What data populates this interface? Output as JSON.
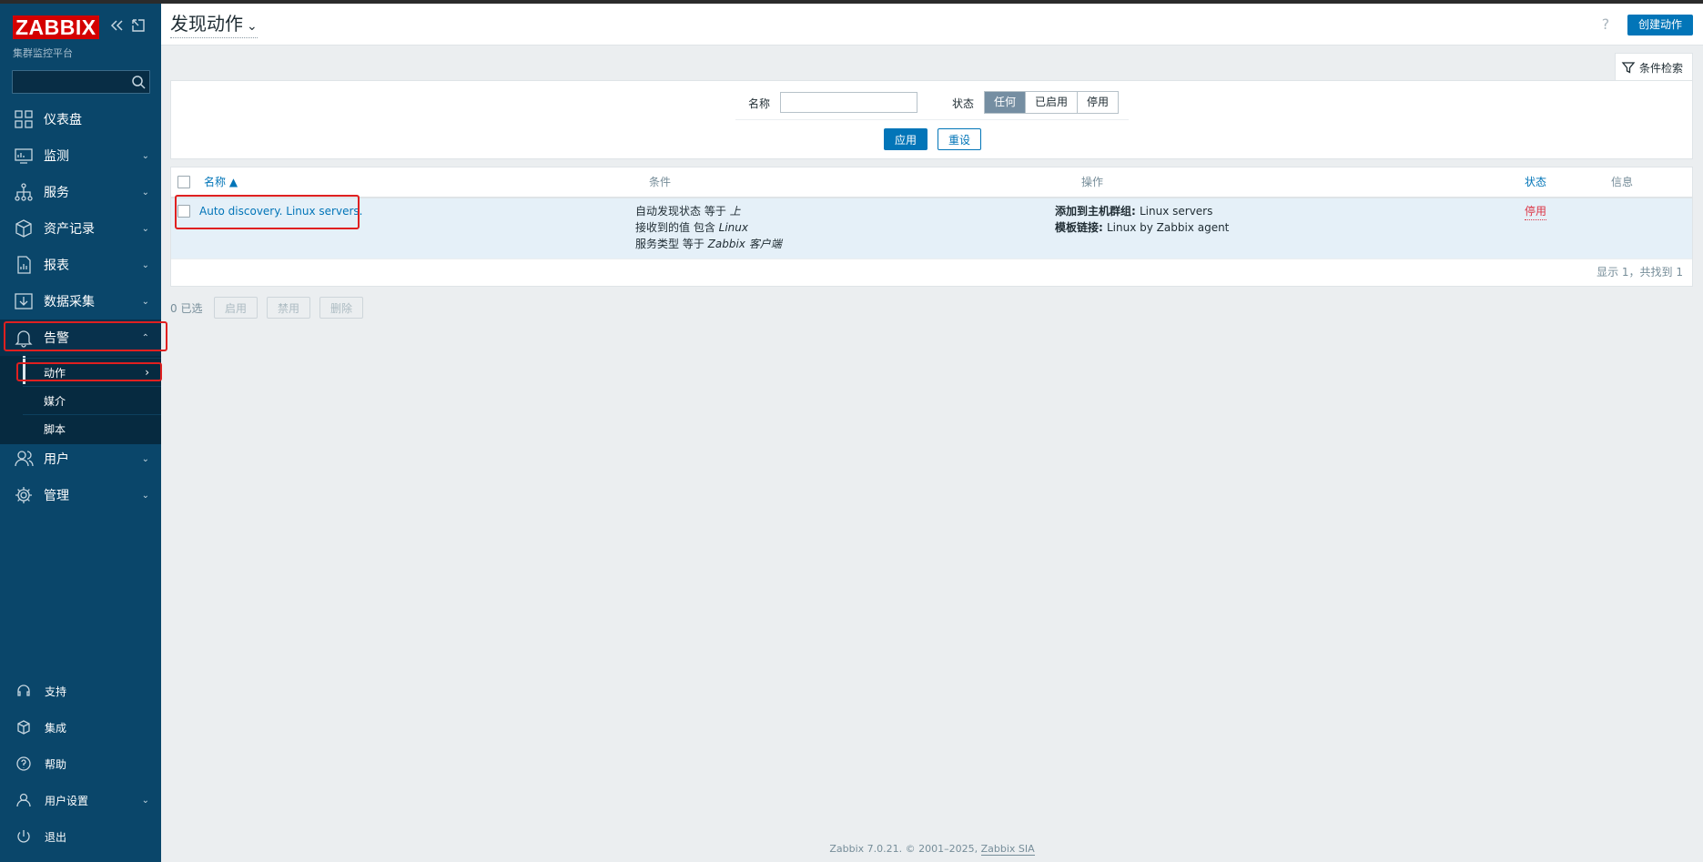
{
  "sidebar": {
    "logo": "ZABBIX",
    "subtitle": "集群监控平台",
    "search_placeholder": "",
    "menu": [
      {
        "label": "仪表盘",
        "icon": "dashboard-icon"
      },
      {
        "label": "监测",
        "icon": "monitoring-icon"
      },
      {
        "label": "服务",
        "icon": "services-icon"
      },
      {
        "label": "资产记录",
        "icon": "inventory-icon"
      },
      {
        "label": "报表",
        "icon": "reports-icon"
      },
      {
        "label": "数据采集",
        "icon": "data-collection-icon"
      },
      {
        "label": "告警",
        "icon": "bell-icon"
      },
      {
        "label": "用户",
        "icon": "users-icon"
      },
      {
        "label": "管理",
        "icon": "gear-icon"
      }
    ],
    "alerts_submenu": [
      {
        "label": "动作"
      },
      {
        "label": "媒介"
      },
      {
        "label": "脚本"
      }
    ],
    "bottom": [
      {
        "label": "支持",
        "icon": "headset-icon"
      },
      {
        "label": "集成",
        "icon": "integrations-icon"
      },
      {
        "label": "帮助",
        "icon": "help-icon"
      },
      {
        "label": "用户设置",
        "icon": "user-settings-icon"
      },
      {
        "label": "退出",
        "icon": "power-icon"
      }
    ]
  },
  "header": {
    "title": "发现动作",
    "help": "?",
    "create_button": "创建动作"
  },
  "filter": {
    "tab_label": "条件检索",
    "name_label": "名称",
    "name_value": "",
    "status_label": "状态",
    "status_options": [
      "任何",
      "已启用",
      "停用"
    ],
    "status_selected": "任何",
    "apply": "应用",
    "reset": "重设"
  },
  "table": {
    "headers": {
      "name": "名称 ▲",
      "conditions": "条件",
      "operations": "操作",
      "status": "状态",
      "info": "信息"
    },
    "rows": [
      {
        "name": "Auto discovery. Linux servers.",
        "conditions": [
          {
            "prefix": "自动发现状态 等于 ",
            "value": "上"
          },
          {
            "prefix": "接收到的值 包含 ",
            "value": "Linux"
          },
          {
            "prefix": "服务类型 等于 ",
            "value": "Zabbix 客户端"
          }
        ],
        "operations": [
          {
            "label": "添加到主机群组: ",
            "value": "Linux servers"
          },
          {
            "label": "模板链接: ",
            "value": "Linux by Zabbix agent"
          }
        ],
        "status": "停用",
        "info": ""
      }
    ],
    "paging": "显示 1，共找到 1"
  },
  "mass_actions": {
    "selected": "0 已选",
    "enable": "启用",
    "disable": "禁用",
    "delete": "删除"
  },
  "footer": {
    "text": "Zabbix 7.0.21. © 2001–2025, ",
    "link": "Zabbix SIA"
  },
  "colors": {
    "sidebar_bg": "#0a466a",
    "accent": "#0275b8",
    "highlight_box": "#e02020",
    "status_disabled": "#dc3545"
  }
}
